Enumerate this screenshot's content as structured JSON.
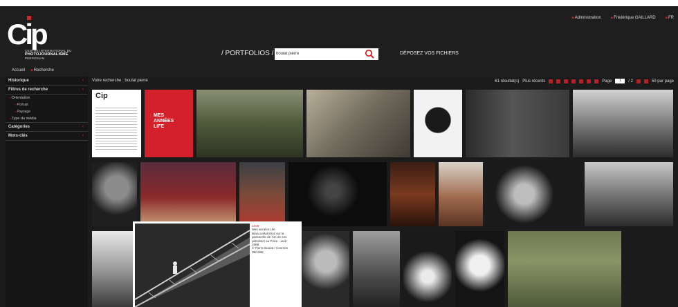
{
  "header": {
    "logo_letters": "Cip",
    "logo_line1": "CENTRE INTERNATIONAL DU",
    "logo_line2": "PHOTOJOURNALISME",
    "logo_line3": "PERPIGNAN",
    "admin_link": "Administration",
    "user_name": "Frédérique GAILLARD",
    "lang_link": "FR"
  },
  "nav": {
    "portfolios": "/ PORTFOLIOS /",
    "deposez": "DÉPOSEZ VOS FICHIERS"
  },
  "search": {
    "value": "boulat pierre",
    "icon": "search-icon"
  },
  "breadcrumb": {
    "home": "Accueil",
    "current": "Recherche"
  },
  "sidebar": {
    "historique": "Historique",
    "filtres": "Filtres de recherche",
    "orientation": "Orientation",
    "portrait": "Portrait",
    "paysage": "Paysage",
    "type_media": "Type du média",
    "categories": "Catégories",
    "mots_cles": "Mots-clés"
  },
  "results": {
    "title": "Votre recherche : boulat pierre",
    "count": "61 résultat(s)",
    "sort": "Plus récents",
    "page_label": "Page",
    "page_current": "1",
    "page_total": "/ 2",
    "per_page": "50 par page"
  },
  "doc_thumb_logo": "Cip",
  "book_cover": {
    "line1": "MES",
    "line2": "ANNÉES",
    "line3": "LIFE"
  },
  "popup": {
    "id": "1008",
    "l1": "Mes années Life",
    "l2": "Bianca Marchioz sur la",
    "l3": "passerelle de l'un de ses",
    "l4": "pétroliers au Pirée - août",
    "l5": "1968",
    "l6": "© Pierre Boulat / Cosmos",
    "l7": "08/1968"
  },
  "colors": {
    "accent": "#d8232a",
    "background": "#1b1b1b"
  }
}
